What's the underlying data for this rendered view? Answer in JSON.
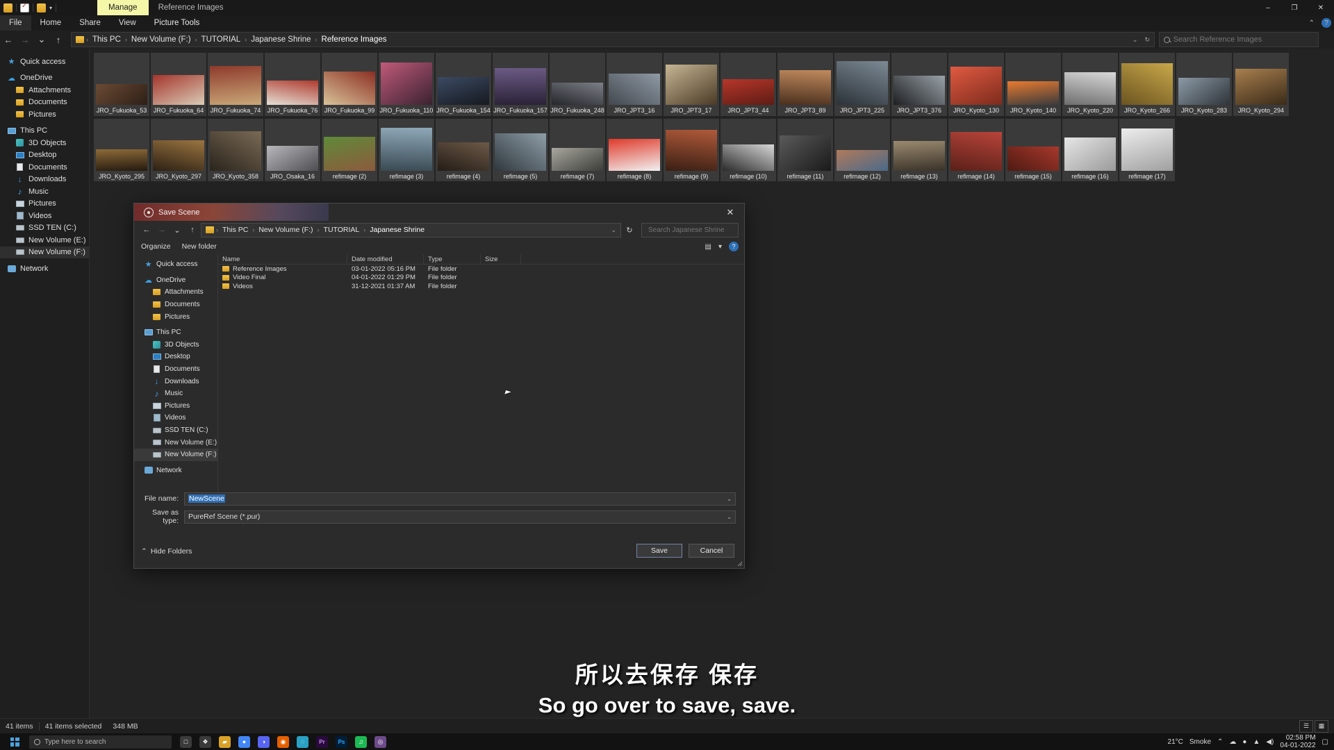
{
  "window": {
    "context_tab": "Manage",
    "context_label": "Reference Images",
    "minimize": "–",
    "maximize": "❐",
    "close": "✕",
    "quick_access_caret": "▾"
  },
  "ribbon": {
    "tabs": [
      "File",
      "Home",
      "Share",
      "View",
      "Picture Tools"
    ],
    "collapse": "⌃",
    "help": "?"
  },
  "address": {
    "back": "←",
    "forward": "→",
    "recent": "⌄",
    "up": "↑",
    "crumbs": [
      "This PC",
      "New Volume (F:)",
      "TUTORIAL",
      "Japanese Shrine",
      "Reference Images"
    ],
    "separator": "›",
    "dropdown": "⌄",
    "refresh": "↻",
    "search_placeholder": "Search Reference Images"
  },
  "navpane": {
    "items": [
      {
        "label": "Quick access",
        "icon": "star-icon",
        "indent": 0,
        "selected": false
      },
      {
        "label": "OneDrive",
        "icon": "cloud-icon",
        "indent": 0,
        "selected": false
      },
      {
        "label": "Attachments",
        "icon": "folder-icon",
        "indent": 1,
        "selected": false
      },
      {
        "label": "Documents",
        "icon": "folder-icon",
        "indent": 1,
        "selected": false
      },
      {
        "label": "Pictures",
        "icon": "folder-icon",
        "indent": 1,
        "selected": false
      },
      {
        "label": "This PC",
        "icon": "pc-icon",
        "indent": 0,
        "selected": false
      },
      {
        "label": "3D Objects",
        "icon": "3d-objects-icon",
        "indent": 1,
        "selected": false
      },
      {
        "label": "Desktop",
        "icon": "desktop-icon",
        "indent": 1,
        "selected": false
      },
      {
        "label": "Documents",
        "icon": "documents-icon",
        "indent": 1,
        "selected": false
      },
      {
        "label": "Downloads",
        "icon": "downloads-icon",
        "indent": 1,
        "selected": false
      },
      {
        "label": "Music",
        "icon": "music-icon",
        "indent": 1,
        "selected": false
      },
      {
        "label": "Pictures",
        "icon": "pictures-icon",
        "indent": 1,
        "selected": false
      },
      {
        "label": "Videos",
        "icon": "videos-icon",
        "indent": 1,
        "selected": false
      },
      {
        "label": "SSD TEN (C:)",
        "icon": "drive-icon",
        "indent": 1,
        "selected": false
      },
      {
        "label": "New Volume (E:)",
        "icon": "drive-icon",
        "indent": 1,
        "selected": false
      },
      {
        "label": "New Volume (F:)",
        "icon": "drive-icon",
        "indent": 1,
        "selected": true
      },
      {
        "label": "Network",
        "icon": "network-icon",
        "indent": 0,
        "selected": false
      }
    ]
  },
  "files": [
    {
      "name": "JRO_Fukuoka_53",
      "c1": "#6b4a34",
      "c2": "#2d1f17"
    },
    {
      "name": "JRO_Fukuoka_64",
      "c1": "#a4352c",
      "c2": "#d9cbb6"
    },
    {
      "name": "JRO_Fukuoka_74",
      "c1": "#8e3a2c",
      "c2": "#caa878"
    },
    {
      "name": "JRO_Fukuoka_76",
      "c1": "#b03a2e",
      "c2": "#e4e0d6"
    },
    {
      "name": "JRO_Fukuoka_99",
      "c1": "#8c2f22",
      "c2": "#d8c39a"
    },
    {
      "name": "JRO_Fukuoka_110",
      "c1": "#c05a7a",
      "c2": "#3a2230"
    },
    {
      "name": "JRO_Fukuoka_154",
      "c1": "#3b4a63",
      "c2": "#16191f"
    },
    {
      "name": "JRO_Fukuoka_157",
      "c1": "#6b5a84",
      "c2": "#2a2237"
    },
    {
      "name": "JRO_Fukuoka_248",
      "c1": "#7d7f86",
      "c2": "#23262b"
    },
    {
      "name": "JRO_JPT3_16",
      "c1": "#8f9aa5",
      "c2": "#43484f"
    },
    {
      "name": "JRO_JPT3_17",
      "c1": "#c7b694",
      "c2": "#4a3a26"
    },
    {
      "name": "JRO_JPT3_44",
      "c1": "#b6362a",
      "c2": "#5e1c14"
    },
    {
      "name": "JRO_JPT3_89",
      "c1": "#c08a5e",
      "c2": "#4a2f1d"
    },
    {
      "name": "JRO_JPT3_225",
      "c1": "#7d8a95",
      "c2": "#2b3238"
    },
    {
      "name": "JRO_JPT3_376",
      "c1": "#9aa2a8",
      "c2": "#1d1f22"
    },
    {
      "name": "JRO_Kyoto_130",
      "c1": "#e05a42",
      "c2": "#7d2b1c"
    },
    {
      "name": "JRO_Kyoto_140",
      "c1": "#e87a30",
      "c2": "#3a3a3c"
    },
    {
      "name": "JRO_Kyoto_220",
      "c1": "#d9d9d9",
      "c2": "#6e6e6e"
    },
    {
      "name": "JRO_Kyoto_266",
      "c1": "#c9a84a",
      "c2": "#6b5420"
    },
    {
      "name": "JRO_Kyoto_283",
      "c1": "#8c9aa6",
      "c2": "#2e3439"
    },
    {
      "name": "JRO_Kyoto_294",
      "c1": "#a87f4e",
      "c2": "#3a2a18"
    },
    {
      "name": "JRO_Kyoto_295",
      "c1": "#8d6a38",
      "c2": "#241a0f"
    },
    {
      "name": "JRO_Kyoto_297",
      "c1": "#9b7540",
      "c2": "#2c2014"
    },
    {
      "name": "JRO_Kyoto_358",
      "c1": "#7a6a55",
      "c2": "#2a241c"
    },
    {
      "name": "JRO_Osaka_16",
      "c1": "#b9b9bd",
      "c2": "#4d4d52"
    },
    {
      "name": "refimage (2)",
      "c1": "#5f8a3a",
      "c2": "#8c5a3c"
    },
    {
      "name": "refimage (3)",
      "c1": "#8fa8b8",
      "c2": "#3a4a54"
    },
    {
      "name": "refimage (4)",
      "c1": "#6d5a48",
      "c2": "#241c16"
    },
    {
      "name": "refimage (5)",
      "c1": "#8f9ea8",
      "c2": "#30383e"
    },
    {
      "name": "refimage (7)",
      "c1": "#a8a8a0",
      "c2": "#3c3c38"
    },
    {
      "name": "refimage (8)",
      "c1": "#e03a2a",
      "c2": "#f2f2f2"
    },
    {
      "name": "refimage (9)",
      "c1": "#b05a3a",
      "c2": "#3a1f14"
    },
    {
      "name": "refimage (10)",
      "c1": "#d8d8d8",
      "c2": "#2a2a2a"
    },
    {
      "name": "refimage (11)",
      "c1": "#5a5a5a",
      "c2": "#1a1a1a"
    },
    {
      "name": "refimage (12)",
      "c1": "#b07a5a",
      "c2": "#4a6a8a"
    },
    {
      "name": "refimage (13)",
      "c1": "#9a8a70",
      "c2": "#3a3228"
    },
    {
      "name": "refimage (14)",
      "c1": "#b8443a",
      "c2": "#5a2018"
    },
    {
      "name": "refimage (15)",
      "c1": "#a8382c",
      "c2": "#4e1a12"
    },
    {
      "name": "refimage (16)",
      "c1": "#e6e6e6",
      "c2": "#9a9a9a"
    },
    {
      "name": "refimage (17)",
      "c1": "#ededed",
      "c2": "#a0a0a0"
    }
  ],
  "status": {
    "item_count": "41 items",
    "selected": "41 items selected",
    "size": "348 MB",
    "view_details": "☰",
    "view_icons": "▦"
  },
  "dialog": {
    "title": "Save Scene",
    "close": "✕",
    "back": "←",
    "forward": "→",
    "recent": "⌄",
    "up": "↑",
    "crumbs": [
      "This PC",
      "New Volume (F:)",
      "TUTORIAL",
      "Japanese Shrine"
    ],
    "separator": "›",
    "dropdown": "⌄",
    "refresh": "↻",
    "search_placeholder": "Search Japanese Shrine",
    "organize": "Organize",
    "organize_caret": "▾",
    "new_folder": "New folder",
    "view_icon": "▤",
    "view_caret": "▾",
    "help": "?",
    "columns": [
      "Name",
      "Date modified",
      "Type",
      "Size"
    ],
    "rows": [
      {
        "name": "Reference Images",
        "modified": "03-01-2022 05:16 PM",
        "type": "File folder",
        "size": ""
      },
      {
        "name": "Video Final",
        "modified": "04-01-2022 01:29 PM",
        "type": "File folder",
        "size": ""
      },
      {
        "name": "Videos",
        "modified": "31-12-2021 01:37 AM",
        "type": "File folder",
        "size": ""
      }
    ],
    "nav_items": [
      {
        "label": "Quick access",
        "icon": "star-icon",
        "indent": 0,
        "selected": false
      },
      {
        "label": "OneDrive",
        "icon": "cloud-icon",
        "indent": 0,
        "selected": false
      },
      {
        "label": "Attachments",
        "icon": "folder-icon",
        "indent": 1,
        "selected": false
      },
      {
        "label": "Documents",
        "icon": "folder-icon",
        "indent": 1,
        "selected": false
      },
      {
        "label": "Pictures",
        "icon": "folder-icon",
        "indent": 1,
        "selected": false
      },
      {
        "label": "This PC",
        "icon": "pc-icon",
        "indent": 0,
        "selected": false
      },
      {
        "label": "3D Objects",
        "icon": "3d-objects-icon",
        "indent": 1,
        "selected": false
      },
      {
        "label": "Desktop",
        "icon": "desktop-icon",
        "indent": 1,
        "selected": false
      },
      {
        "label": "Documents",
        "icon": "documents-icon",
        "indent": 1,
        "selected": false
      },
      {
        "label": "Downloads",
        "icon": "downloads-icon",
        "indent": 1,
        "selected": false
      },
      {
        "label": "Music",
        "icon": "music-icon",
        "indent": 1,
        "selected": false
      },
      {
        "label": "Pictures",
        "icon": "pictures-icon",
        "indent": 1,
        "selected": false
      },
      {
        "label": "Videos",
        "icon": "videos-icon",
        "indent": 1,
        "selected": false
      },
      {
        "label": "SSD TEN (C:)",
        "icon": "drive-icon",
        "indent": 1,
        "selected": false
      },
      {
        "label": "New Volume (E:)",
        "icon": "drive-icon",
        "indent": 1,
        "selected": false
      },
      {
        "label": "New Volume (F:)",
        "icon": "drive-icon",
        "indent": 1,
        "selected": true
      },
      {
        "label": "Network",
        "icon": "network-icon",
        "indent": 0,
        "selected": false
      }
    ],
    "filename_label": "File name:",
    "filename_value": "NewScene",
    "filetype_label": "Save as type:",
    "filetype_value": "PureRef Scene (*.pur)",
    "hide_folders": "Hide Folders",
    "hide_folders_caret": "⌃",
    "save_button": "Save",
    "cancel_button": "Cancel"
  },
  "subtitles": {
    "chinese": "所以去保存 保存",
    "english": "So go over to save, save."
  },
  "taskbar": {
    "search_placeholder": "Type here to search",
    "apps": [
      {
        "name": "task-view-icon",
        "glyph": "□",
        "color": "#3a3a3a"
      },
      {
        "name": "widgets-icon",
        "glyph": "❖",
        "color": "#3a3a3a"
      },
      {
        "name": "file-explorer-icon",
        "glyph": "▰",
        "color": "#d9a227"
      },
      {
        "name": "chrome-icon",
        "glyph": "●",
        "color": "#4285f4"
      },
      {
        "name": "discord-icon",
        "glyph": "◑",
        "color": "#5865f2"
      },
      {
        "name": "firefox-icon",
        "glyph": "◉",
        "color": "#e66000"
      },
      {
        "name": "edge-icon",
        "glyph": "◌",
        "color": "#2aa0c4"
      },
      {
        "name": "premiere-icon",
        "glyph": "Pr",
        "color": "#2a0a3c"
      },
      {
        "name": "photoshop-icon",
        "glyph": "Ps",
        "color": "#001e36"
      },
      {
        "name": "spotify-icon",
        "glyph": "♫",
        "color": "#1db954"
      },
      {
        "name": "pureref-icon",
        "glyph": "◎",
        "color": "#6d4a8a"
      }
    ],
    "weather_temp": "21°C",
    "weather_desc": "Smoke",
    "tray_up": "⌃",
    "tray_cloud": "☁",
    "tray_mic": "●",
    "tray_net": "▲",
    "tray_vol": "◀)",
    "time": "02:58 PM",
    "date": "04-01-2022",
    "notification": "▢"
  }
}
